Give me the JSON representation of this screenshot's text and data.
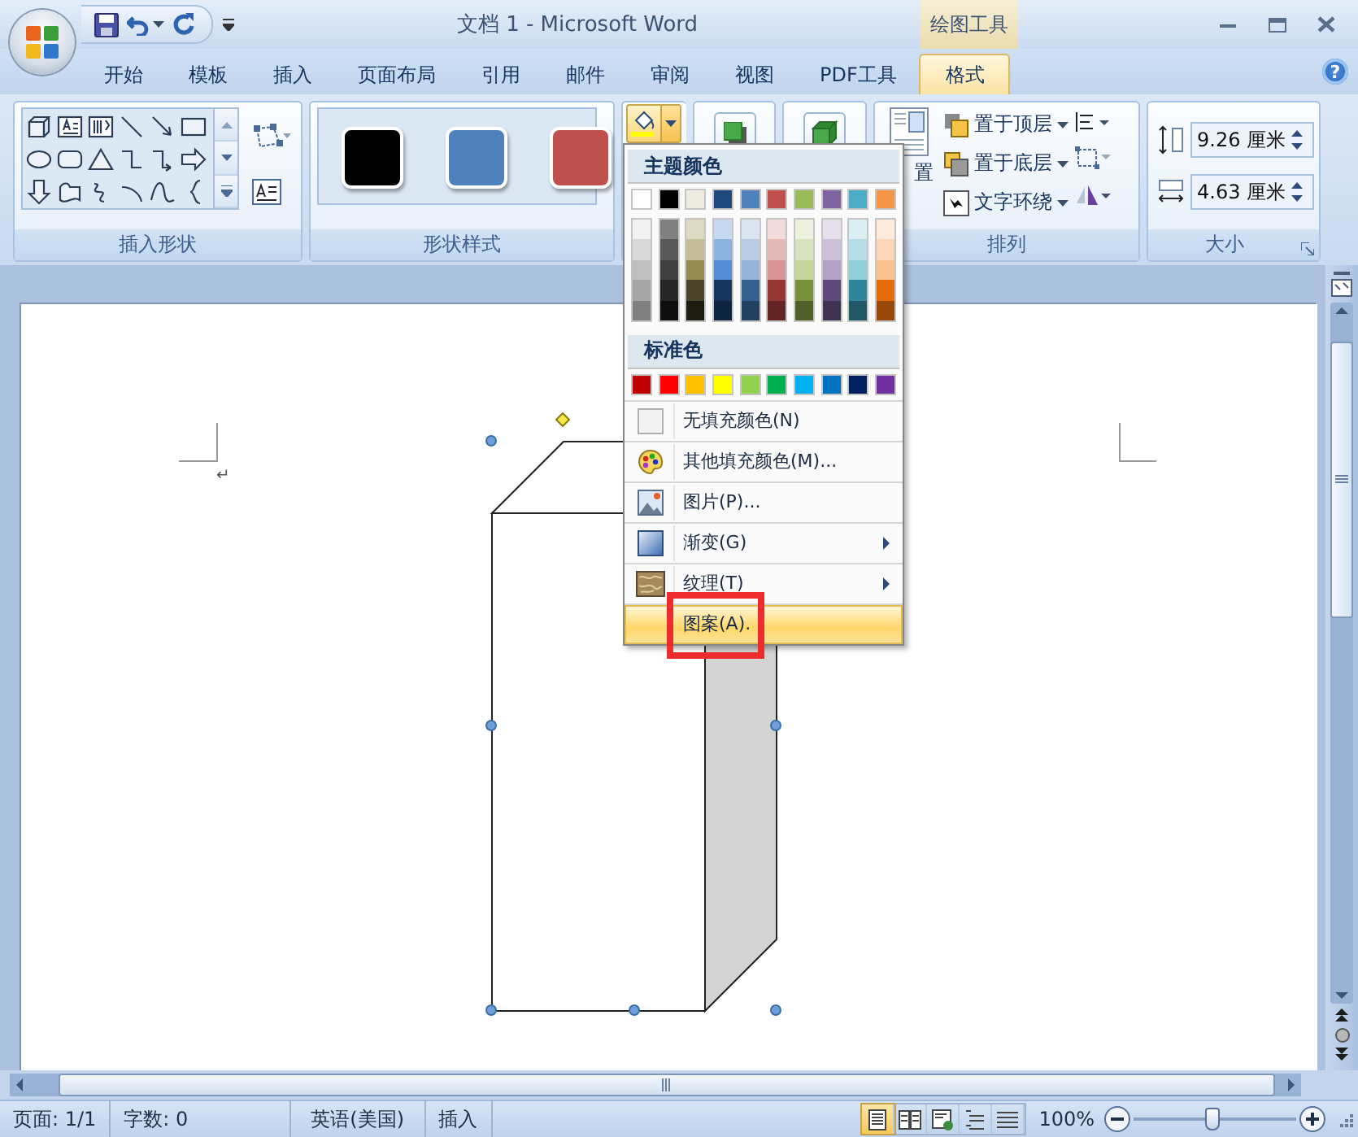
{
  "window": {
    "title": "文档 1 - Microsoft Word",
    "context_group": "绘图工具"
  },
  "tabs": [
    {
      "label": "开始",
      "selected": false
    },
    {
      "label": "模板",
      "selected": false
    },
    {
      "label": "插入",
      "selected": false
    },
    {
      "label": "页面布局",
      "selected": false
    },
    {
      "label": "引用",
      "selected": false
    },
    {
      "label": "邮件",
      "selected": false
    },
    {
      "label": "审阅",
      "selected": false
    },
    {
      "label": "视图",
      "selected": false
    },
    {
      "label": "PDF工具",
      "selected": false
    },
    {
      "label": "格式",
      "selected": true
    }
  ],
  "help": "?",
  "ribbon": {
    "shapes_label": "插入形状",
    "styles_label": "形状样式",
    "style_swatches": [
      {
        "color": "#000000"
      },
      {
        "color": "#4f81bd"
      },
      {
        "color": "#c0504d"
      }
    ],
    "fill_button": {
      "expanded": true
    },
    "position_label": "置",
    "arrange_label": "排列",
    "arrange_buttons": [
      {
        "kind": "front",
        "label": "置于顶层"
      },
      {
        "kind": "back",
        "label": "置于底层"
      },
      {
        "kind": "wrap",
        "label": "文字环绕"
      }
    ],
    "size_label": "大小",
    "height": "9.26 厘米",
    "width": "4.63 厘米"
  },
  "fill_menu": {
    "theme_heading": "主题颜色",
    "theme_colors": [
      {
        "color": "#ffffff"
      },
      {
        "color": "#000000"
      },
      {
        "color": "#eeece1"
      },
      {
        "color": "#1f497d"
      },
      {
        "color": "#4f81bd"
      },
      {
        "color": "#c0504d"
      },
      {
        "color": "#9bbb59"
      },
      {
        "color": "#8064a2"
      },
      {
        "color": "#4bacc6"
      },
      {
        "color": "#f79646"
      }
    ],
    "shade_columns": [
      {
        "shades": [
          {
            "color": "#f2f2f2"
          },
          {
            "color": "#d9d9d9"
          },
          {
            "color": "#bfbfbf"
          },
          {
            "color": "#a6a6a6"
          },
          {
            "color": "#808080"
          }
        ]
      },
      {
        "shades": [
          {
            "color": "#808080"
          },
          {
            "color": "#595959"
          },
          {
            "color": "#404040"
          },
          {
            "color": "#262626"
          },
          {
            "color": "#0d0d0d"
          }
        ]
      },
      {
        "shades": [
          {
            "color": "#ddd9c3"
          },
          {
            "color": "#c4bd97"
          },
          {
            "color": "#948a54"
          },
          {
            "color": "#4a452a"
          },
          {
            "color": "#1e1c11"
          }
        ]
      },
      {
        "shades": [
          {
            "color": "#c6d9f0"
          },
          {
            "color": "#8db3e2"
          },
          {
            "color": "#548dd4"
          },
          {
            "color": "#17365d"
          },
          {
            "color": "#0f243e"
          }
        ]
      },
      {
        "shades": [
          {
            "color": "#dbe5f1"
          },
          {
            "color": "#b8cce4"
          },
          {
            "color": "#95b3d7"
          },
          {
            "color": "#366092"
          },
          {
            "color": "#244061"
          }
        ]
      },
      {
        "shades": [
          {
            "color": "#f2dcdb"
          },
          {
            "color": "#e5b9b7"
          },
          {
            "color": "#d99694"
          },
          {
            "color": "#953734"
          },
          {
            "color": "#632423"
          }
        ]
      },
      {
        "shades": [
          {
            "color": "#ebf1dd"
          },
          {
            "color": "#d7e3bc"
          },
          {
            "color": "#c3d69b"
          },
          {
            "color": "#76923c"
          },
          {
            "color": "#4f6128"
          }
        ]
      },
      {
        "shades": [
          {
            "color": "#e5e0ec"
          },
          {
            "color": "#ccc1d9"
          },
          {
            "color": "#b2a2c7"
          },
          {
            "color": "#5f497a"
          },
          {
            "color": "#3f3151"
          }
        ]
      },
      {
        "shades": [
          {
            "color": "#dbeef3"
          },
          {
            "color": "#b7dde8"
          },
          {
            "color": "#92cddc"
          },
          {
            "color": "#31859b"
          },
          {
            "color": "#205867"
          }
        ]
      },
      {
        "shades": [
          {
            "color": "#fdeada"
          },
          {
            "color": "#fbd5b5"
          },
          {
            "color": "#fac08f"
          },
          {
            "color": "#e36c09"
          },
          {
            "color": "#974806"
          }
        ]
      }
    ],
    "standard_heading": "标准色",
    "standard_colors": [
      {
        "color": "#c00000"
      },
      {
        "color": "#ff0000"
      },
      {
        "color": "#ffc000"
      },
      {
        "color": "#ffff00"
      },
      {
        "color": "#92d050"
      },
      {
        "color": "#00b050"
      },
      {
        "color": "#00b0f0"
      },
      {
        "color": "#0070c0"
      },
      {
        "color": "#002060"
      },
      {
        "color": "#7030a0"
      }
    ],
    "items": [
      {
        "kind": "none",
        "label": "无填充颜色(N)",
        "submenu": false,
        "selected": false,
        "framed": false
      },
      {
        "kind": "more",
        "label": "其他填充颜色(M)...",
        "submenu": false,
        "selected": false,
        "framed": false
      },
      {
        "kind": "picture",
        "label": "图片(P)...",
        "submenu": false,
        "selected": false,
        "framed": false
      },
      {
        "kind": "gradient",
        "label": "渐变(G)",
        "submenu": true,
        "selected": false,
        "framed": false
      },
      {
        "kind": "texture",
        "label": "纹理(T)",
        "submenu": true,
        "selected": false,
        "framed": false
      },
      {
        "kind": "pattern",
        "label": "图案(A).",
        "submenu": false,
        "selected": true,
        "framed": true
      }
    ]
  },
  "document": {
    "paragraph_mark": "↵",
    "shape": {
      "selected": true
    }
  },
  "status_bar": {
    "fields": [
      "页面: 1/1",
      "字数: 0",
      "英语(美国)",
      "插入"
    ],
    "view_buttons": [
      {
        "kind": "print",
        "selected": true
      },
      {
        "kind": "reading",
        "selected": false
      },
      {
        "kind": "web",
        "selected": false
      },
      {
        "kind": "outline",
        "selected": false
      },
      {
        "kind": "draft",
        "selected": false
      }
    ],
    "zoom": "100%",
    "zoom_slider": {
      "level": 0.47
    }
  }
}
